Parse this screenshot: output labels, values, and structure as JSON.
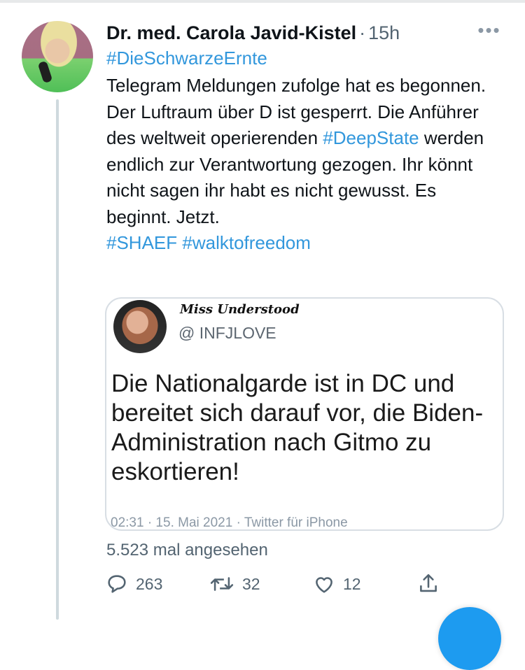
{
  "tweet": {
    "author_name": "Dr. med. Carola Javid-Kistel",
    "separator": "·",
    "time": "15h",
    "more_label": "•••",
    "hashtag_line": "#DieSchwarzeErnte",
    "text": {
      "part1": "Telegram Meldungen zufolge hat es begonnen. Der Luftraum über D ist gesperrt. Die Anführer des weltweit operierenden ",
      "tag1": "#DeepState",
      "part2": " werden endlich zur Verantwortung gezogen. Ihr könnt nicht sagen ihr habt es nicht gewusst. Es beginnt. Jetzt.",
      "tag2": "#SHAEF",
      "space": " ",
      "tag3": "#walktofreedom"
    },
    "quote": {
      "name": "Miss Understood",
      "handle": "@ INFJLOVE",
      "text": "Die Nationalgarde ist in DC und bereitet sich darauf vor, die Biden-Administration nach Gitmo zu eskortieren!",
      "meta": "02:31 · 15. Mai 2021 · Twitter für iPhone"
    },
    "views": "5.523 mal angesehen",
    "actions": {
      "reply_count": "263",
      "retweet_count": "32",
      "like_count": "12"
    }
  },
  "colors": {
    "link": "#3297dc",
    "muted": "#536471",
    "fab": "#1d9bf0"
  },
  "icons": {
    "reply": "reply-icon",
    "retweet": "retweet-icon",
    "like": "heart-icon",
    "share": "share-icon",
    "more": "more-dots-icon"
  }
}
